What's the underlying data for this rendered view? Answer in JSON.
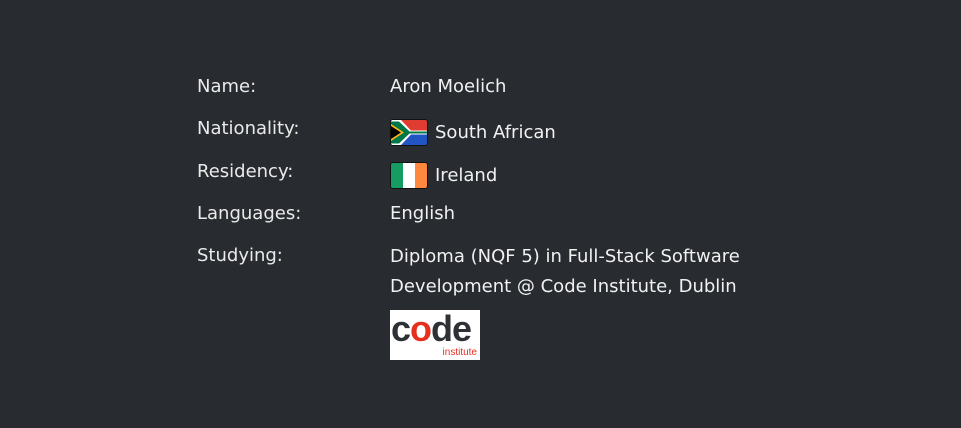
{
  "profile": {
    "name": {
      "label": "Name:",
      "value": "Aron Moelich"
    },
    "nationality": {
      "label": "Nationality:",
      "value": "South African",
      "flag_icon": "south-africa-flag-icon"
    },
    "residency": {
      "label": "Residency:",
      "value": "Ireland",
      "flag_icon": "ireland-flag-icon"
    },
    "languages": {
      "label": "Languages:",
      "value": "English"
    },
    "studying": {
      "label": "Studying:",
      "value_line1": "Diploma (NQF 5) in Full-Stack Software",
      "value_line2": "Development @ Code Institute, Dublin",
      "logo": {
        "part1": "c",
        "part2": "o",
        "part3": "de",
        "sub": "institute"
      }
    }
  },
  "colors": {
    "background": "#282b30",
    "text": "#eaeaea",
    "logo_accent": "#e53020"
  }
}
